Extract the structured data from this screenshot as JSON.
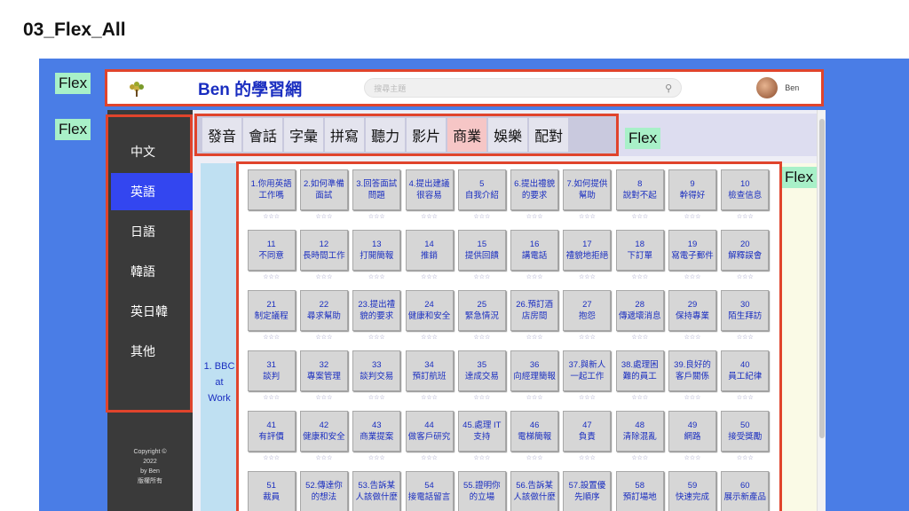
{
  "slide_title": "03_Flex_All",
  "flex_labels": [
    "Flex",
    "Flex",
    "Flex",
    "Flex"
  ],
  "header": {
    "site_title": "Ben 的學習網",
    "search_placeholder": "搜尋主題",
    "search_icon": "search-icon",
    "user_name": "Ben"
  },
  "sidebar": {
    "items": [
      {
        "label": "中文"
      },
      {
        "label": "英語",
        "active": true
      },
      {
        "label": "日語"
      },
      {
        "label": "韓語"
      },
      {
        "label": "英日韓"
      },
      {
        "label": "其他"
      }
    ],
    "copyright": [
      "Copyright ©",
      "2022",
      "by Ben",
      "版權所有"
    ]
  },
  "tabs": [
    {
      "label": "發音"
    },
    {
      "label": "會話"
    },
    {
      "label": "字彙"
    },
    {
      "label": "拼寫"
    },
    {
      "label": "聽力"
    },
    {
      "label": "影片"
    },
    {
      "label": "商業",
      "active": true
    },
    {
      "label": "娛樂"
    },
    {
      "label": "配對"
    }
  ],
  "series_label": [
    "1. BBC",
    "at",
    "Work"
  ],
  "rating": "☆☆☆",
  "cards": [
    [
      "1.你用英語",
      "工作嗎"
    ],
    [
      "2.如何準備",
      "面試"
    ],
    [
      "3.回答面試",
      "問題"
    ],
    [
      "4.提出建議",
      "很容易"
    ],
    [
      "5",
      "自我介紹"
    ],
    [
      "6.提出禮貌",
      "的要求"
    ],
    [
      "7.如何提供",
      "幫助"
    ],
    [
      "8",
      "說對不起"
    ],
    [
      "9",
      "幹得好"
    ],
    [
      "10",
      "檢查信息"
    ],
    [
      "11",
      "不同意"
    ],
    [
      "12",
      "長時間工作"
    ],
    [
      "13",
      "打開簡報"
    ],
    [
      "14",
      "推銷"
    ],
    [
      "15",
      "提供回饋"
    ],
    [
      "16",
      "講電話"
    ],
    [
      "17",
      "禮貌地拒絕"
    ],
    [
      "18",
      "下訂單"
    ],
    [
      "19",
      "寫電子郵件"
    ],
    [
      "20",
      "解釋誤會"
    ],
    [
      "21",
      "制定議程"
    ],
    [
      "22",
      "尋求幫助"
    ],
    [
      "23.提出禮",
      "貌的要求"
    ],
    [
      "24",
      "健康和安全"
    ],
    [
      "25",
      "緊急情況"
    ],
    [
      "26.預訂酒",
      "店房間"
    ],
    [
      "27",
      "抱怨"
    ],
    [
      "28",
      "傳遞壞消息"
    ],
    [
      "29",
      "保持專業"
    ],
    [
      "30",
      "陌生拜訪"
    ],
    [
      "31",
      "談判"
    ],
    [
      "32",
      "專案管理"
    ],
    [
      "33",
      "談判交易"
    ],
    [
      "34",
      "預訂航班"
    ],
    [
      "35",
      "達成交易"
    ],
    [
      "36",
      "向經理簡報"
    ],
    [
      "37.與新人",
      "一起工作"
    ],
    [
      "38.處理困",
      "難的員工"
    ],
    [
      "39.良好的",
      "客戶關係"
    ],
    [
      "40",
      "員工紀律"
    ],
    [
      "41",
      "有評價"
    ],
    [
      "42",
      "健康和安全"
    ],
    [
      "43",
      "商業提案"
    ],
    [
      "44",
      "做客戶研究"
    ],
    [
      "45.處理 IT",
      "支持"
    ],
    [
      "46",
      "電梯簡報"
    ],
    [
      "47",
      "負責"
    ],
    [
      "48",
      "清除混亂"
    ],
    [
      "49",
      "網路"
    ],
    [
      "50",
      "接受獎勵"
    ],
    [
      "51",
      "裁員"
    ],
    [
      "52.傳達你",
      "的想法"
    ],
    [
      "53.告訴某",
      "人該做什麼"
    ],
    [
      "54",
      "接電話留言"
    ],
    [
      "55.證明你",
      "的立場"
    ],
    [
      "56.告訴某",
      "人該做什麼"
    ],
    [
      "57.設置優",
      "先順序"
    ],
    [
      "58",
      "預訂場地"
    ],
    [
      "59",
      "快速完成"
    ],
    [
      "60",
      "展示新產品"
    ]
  ]
}
